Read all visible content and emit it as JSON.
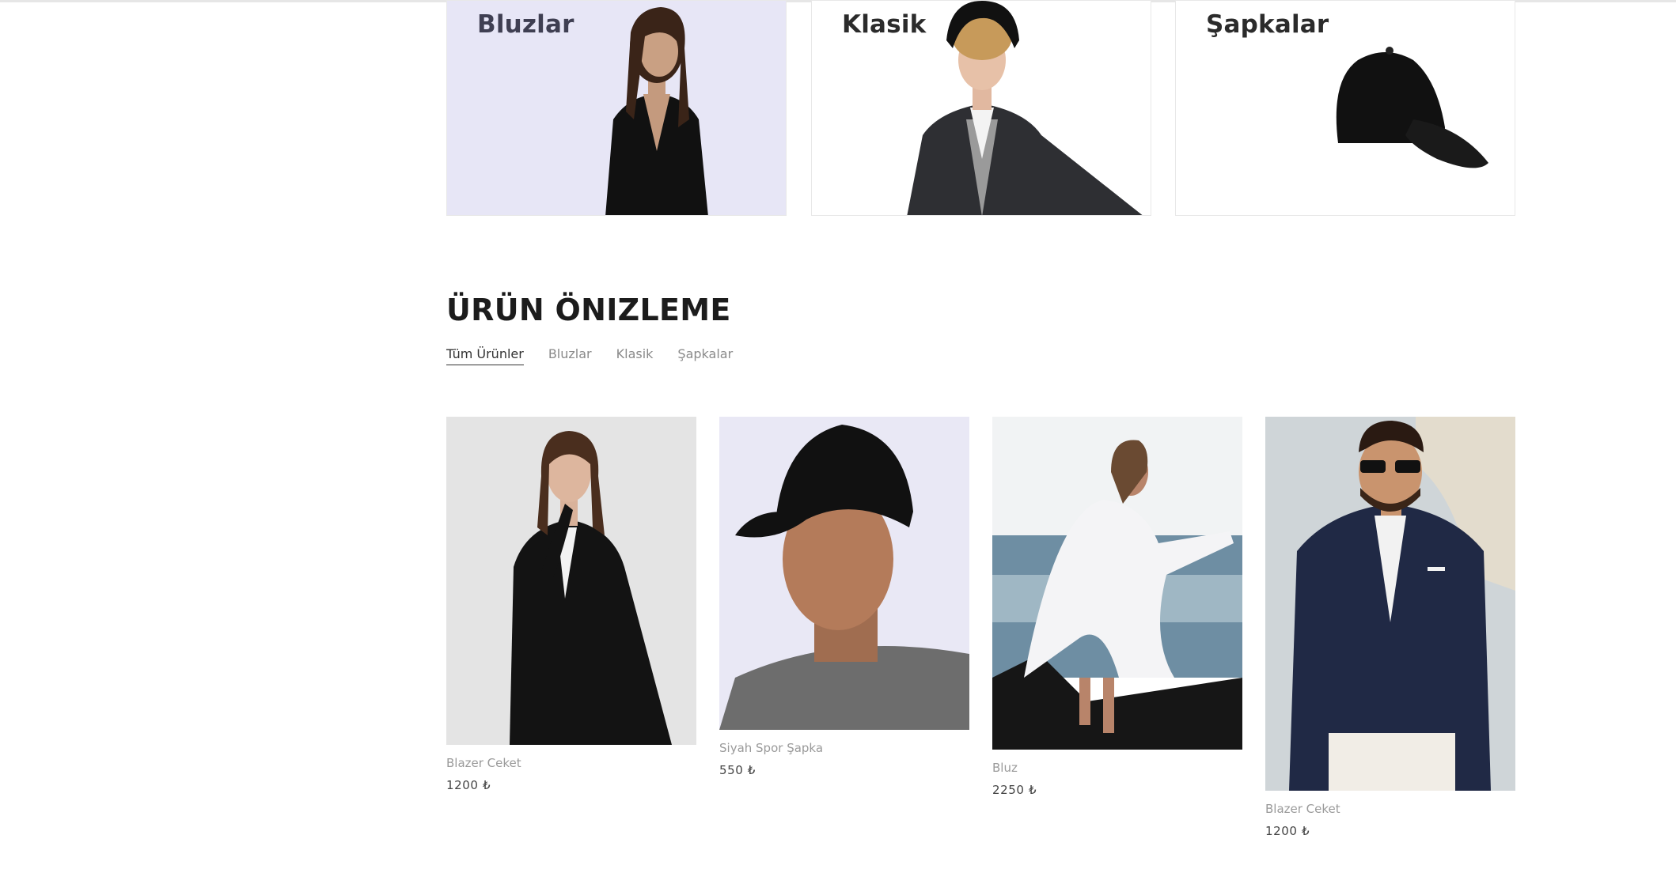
{
  "categories": [
    {
      "title": "Bluzlar",
      "image": "woman-black-blouse-photo"
    },
    {
      "title": "Klasik",
      "image": "man-blazer-hat-photo"
    },
    {
      "title": "Şapkalar",
      "image": "black-cap-photo"
    }
  ],
  "preview": {
    "title": "ÜRÜN ÖNIZLEME",
    "filters": [
      "Tüm Ürünler",
      "Bluzlar",
      "Klasik",
      "Şapkalar"
    ],
    "active_filter": "Tüm Ürünler"
  },
  "products": [
    {
      "name": "Blazer Ceket",
      "price": "1200 ₺",
      "image": "woman-black-blazer-photo"
    },
    {
      "name": "Siyah Spor Şapka",
      "price": "550 ₺",
      "image": "man-black-cap-photo"
    },
    {
      "name": "Bluz",
      "price": "2250 ₺",
      "image": "woman-white-blouse-sea-photo"
    },
    {
      "name": "Blazer Ceket",
      "price": "1200 ₺",
      "image": "man-navy-blazer-photo"
    }
  ],
  "colors": {
    "accent": "#1c1c1c",
    "muted": "#9a9a9a",
    "banner_bg": "#e7e6f6"
  }
}
